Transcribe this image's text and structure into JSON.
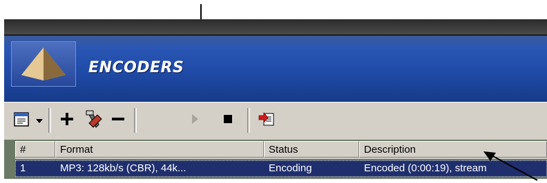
{
  "window": {
    "header": {
      "title": "ENCODERS",
      "accent_color": "#1f4aa6"
    },
    "toolbar": {
      "buttons": [
        {
          "name": "encoder-list-menu",
          "icon": "clipboard-icon"
        },
        {
          "name": "dropdown-arrow",
          "icon": "chevron-down-icon"
        },
        {
          "name": "add-encoder",
          "icon": "plus-icon"
        },
        {
          "name": "configure-encoder",
          "icon": "tools-icon"
        },
        {
          "name": "remove-encoder",
          "icon": "minus-icon"
        },
        {
          "name": "play",
          "icon": "play-icon"
        },
        {
          "name": "stop",
          "icon": "stop-icon"
        },
        {
          "name": "export",
          "icon": "export-icon"
        }
      ]
    },
    "table": {
      "columns": [
        "#",
        "Format",
        "Status",
        "Description"
      ],
      "rows": [
        {
          "index": "1",
          "format": "MP3: 128kb/s (CBR), 44k...",
          "status": "Encoding",
          "description": "Encoded (0:00:19), stream"
        }
      ]
    }
  }
}
